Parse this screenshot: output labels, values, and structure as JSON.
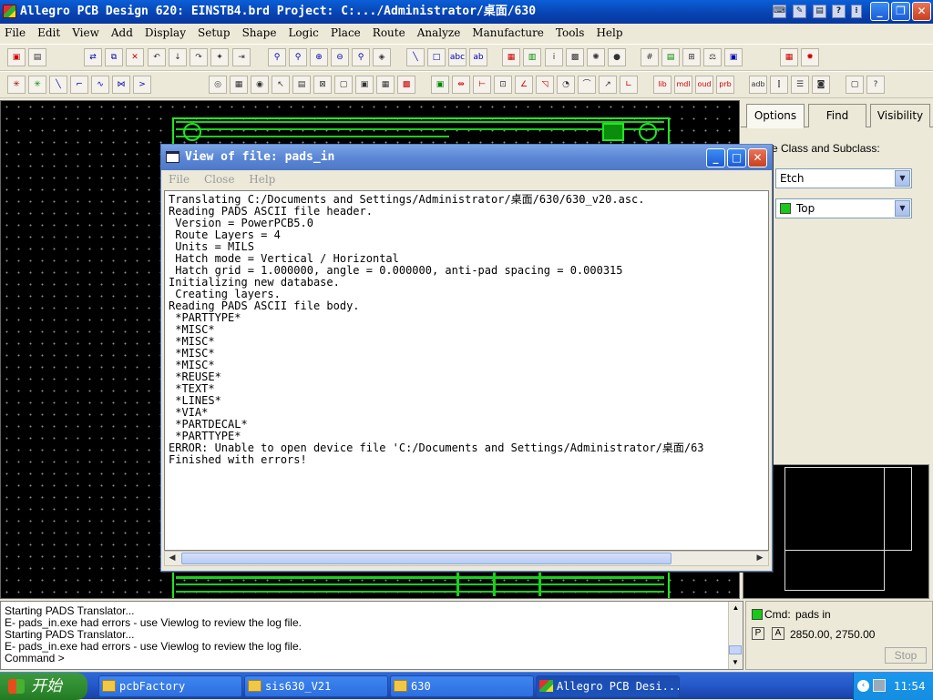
{
  "window": {
    "title": "Allegro PCB Design 620: EINSTB4.brd  Project: C:.../Administrator/桌面/630"
  },
  "menu": [
    "File",
    "Edit",
    "View",
    "Add",
    "Display",
    "Setup",
    "Shape",
    "Logic",
    "Place",
    "Route",
    "Analyze",
    "Manufacture",
    "Tools",
    "Help"
  ],
  "toolbar2_labels": {
    "lib": "lib",
    "mdl": "mdl",
    "oud": "oud",
    "prb": "prb",
    "adb": "adb"
  },
  "viewer": {
    "title": "View of file: pads_in",
    "menu": [
      "File",
      "Close",
      "Help"
    ],
    "lines": [
      "Translating C:/Documents and Settings/Administrator/桌面/630/630_v20.asc.",
      "Reading PADS ASCII file header.",
      " Version = PowerPCB5.0",
      " Route Layers = 4",
      " Units = MILS",
      " Hatch mode = Vertical / Horizontal",
      " Hatch grid = 1.000000, angle = 0.000000, anti-pad spacing = 0.000315",
      "Initializing new database.",
      " Creating layers.",
      "Reading PADS ASCII file body.",
      " *PARTTYPE*",
      " *MISC*",
      " *MISC*",
      " *MISC*",
      " *MISC*",
      " *REUSE*",
      " *TEXT*",
      " *LINES*",
      " *VIA*",
      " *PARTDECAL*",
      " *PARTTYPE*",
      "ERROR: Unable to open device file 'C:/Documents and Settings/Administrator/桌面/63",
      "Finished with errors!"
    ]
  },
  "panel": {
    "tabs": [
      "Options",
      "Find",
      "Visibility"
    ],
    "class_label": "e Class and Subclass:",
    "class_value": "Etch",
    "subclass_value": "Top",
    "subclass_color": "#19c819"
  },
  "console": {
    "lines": [
      "Starting PADS Translator...",
      "E- pads_in.exe had errors - use Viewlog to review the log file.",
      "Starting PADS Translator...",
      "E- pads_in.exe had errors - use Viewlog to review the log file.",
      "Command >"
    ]
  },
  "status": {
    "cmd_label": "Cmd:",
    "cmd_value": "pads in",
    "p": "P",
    "a": "A",
    "coords": "2850.00, 2750.00",
    "stop": "Stop"
  },
  "taskbar": {
    "start": "开始",
    "tasks": [
      "pcbFactory",
      "sis630_V21",
      "630",
      "Allegro PCB Desi..."
    ],
    "time": "11:54"
  }
}
